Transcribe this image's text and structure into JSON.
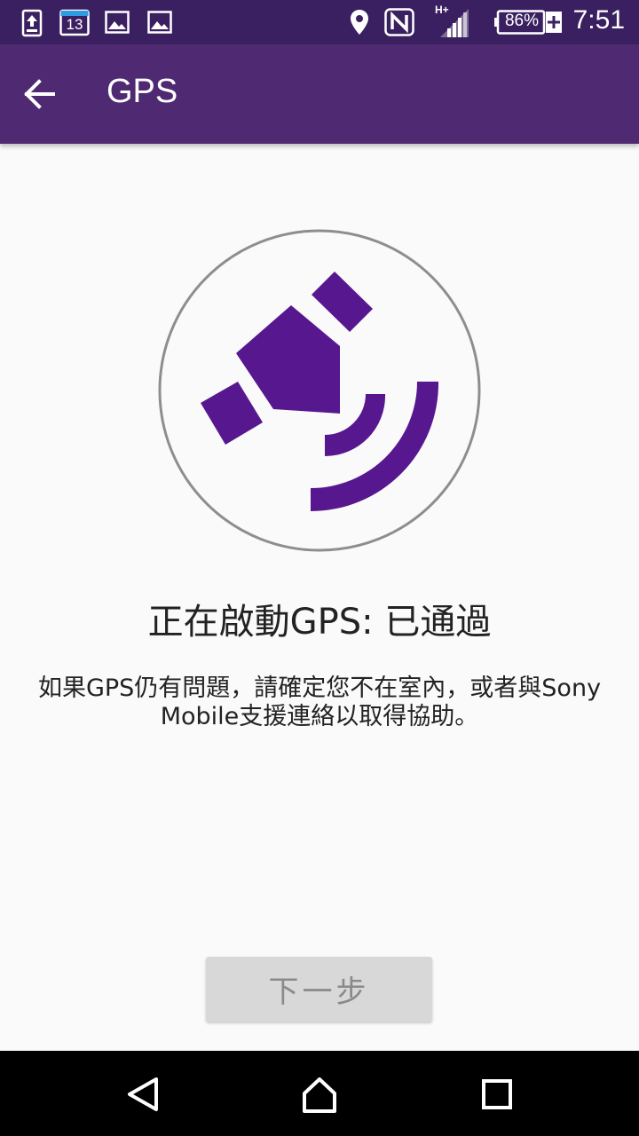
{
  "status_bar": {
    "calendar_day": "13",
    "battery_percent": "86%",
    "network_type": "H+",
    "time": "7:51",
    "icons": [
      "upload-icon",
      "calendar-icon",
      "image-icon",
      "image-icon",
      "location-icon",
      "nfc-icon",
      "signal-icon",
      "battery-icon"
    ]
  },
  "app_bar": {
    "title": "GPS",
    "back_icon": "arrow-back-icon"
  },
  "main": {
    "illustration": "satellite-icon",
    "accent_color": "#56178f",
    "status_title": "正在啟動GPS: 已通過",
    "help_text": "如果GPS仍有問題，請確定您不在室內，或者與Sony Mobile支援連絡以取得協助。"
  },
  "footer": {
    "next_label": "下一步"
  },
  "nav_bar": {
    "icons": [
      "back-triangle-icon",
      "home-icon",
      "recents-icon"
    ]
  }
}
